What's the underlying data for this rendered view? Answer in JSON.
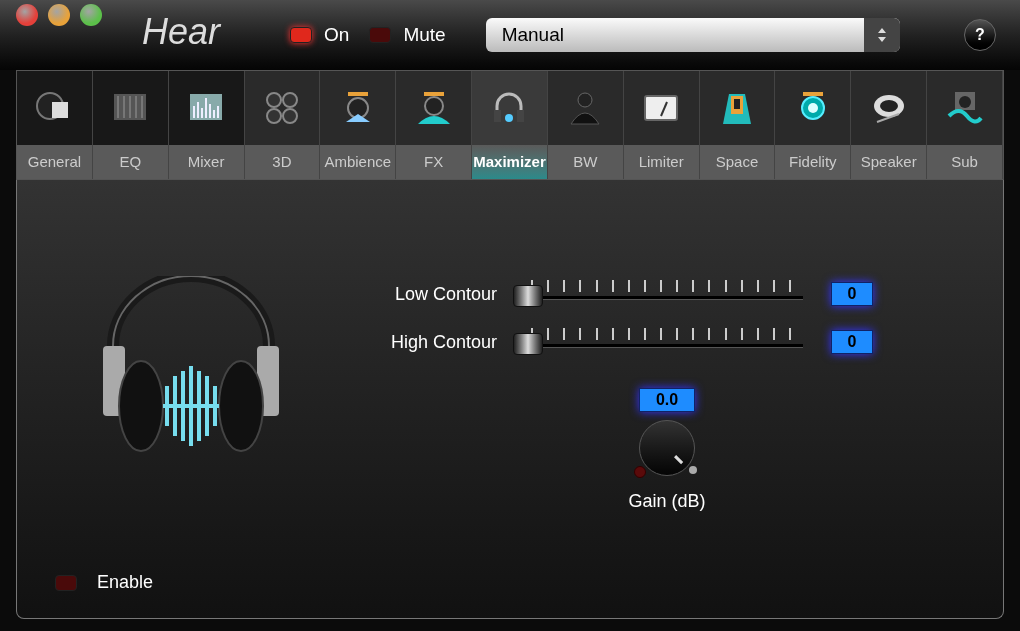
{
  "window": {
    "title": "Hear"
  },
  "power": {
    "label": "On",
    "on": true
  },
  "mute": {
    "label": "Mute",
    "on": false
  },
  "preset": {
    "value": "Manual"
  },
  "help": {
    "label": "?"
  },
  "tabs": [
    {
      "label": "General",
      "selected": false
    },
    {
      "label": "EQ",
      "selected": false
    },
    {
      "label": "Mixer",
      "selected": false
    },
    {
      "label": "3D",
      "selected": false
    },
    {
      "label": "Ambience",
      "selected": false
    },
    {
      "label": "FX",
      "selected": false
    },
    {
      "label": "Maximizer",
      "selected": true
    },
    {
      "label": "BW",
      "selected": false
    },
    {
      "label": "Limiter",
      "selected": false
    },
    {
      "label": "Space",
      "selected": false
    },
    {
      "label": "Fidelity",
      "selected": false
    },
    {
      "label": "Speaker",
      "selected": false
    },
    {
      "label": "Sub",
      "selected": false
    }
  ],
  "sliders": [
    {
      "label": "Low Contour",
      "level": 0,
      "reading": "0"
    },
    {
      "label": "High Contour",
      "level": 0,
      "reading": "0"
    }
  ],
  "gain": {
    "label": "Gain (dB)",
    "reading": "0.0"
  },
  "enable": {
    "label": "Enable",
    "on": false
  }
}
